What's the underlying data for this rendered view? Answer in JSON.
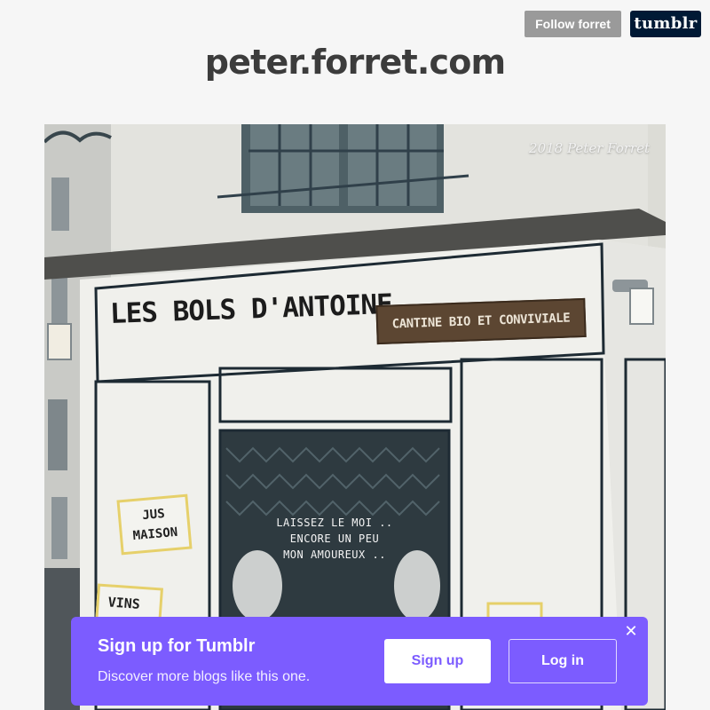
{
  "header": {
    "follow_label": "Follow forret",
    "tumblr_logo": "tumblr",
    "blog_title": "peter.forret.com"
  },
  "photo": {
    "credit": "2018 Peter Forret",
    "sign_main": "LES BOLS D'ANTOINE",
    "sign_secondary": "CANTINE BIO ET CONVIVIALE",
    "shutter_text": [
      "LAISSEZ LE MOI ..",
      "ENCORE UN PEU",
      "MON AMOUREUX .."
    ],
    "poster_1": [
      "JUS",
      "MAISON"
    ],
    "poster_2": "VINS"
  },
  "signup_banner": {
    "title": "Sign up for Tumblr",
    "subtitle": "Discover more blogs like this one.",
    "signup_label": "Sign up",
    "login_label": "Log in",
    "close_icon": "close-icon",
    "accent_color": "#7c5cff"
  }
}
